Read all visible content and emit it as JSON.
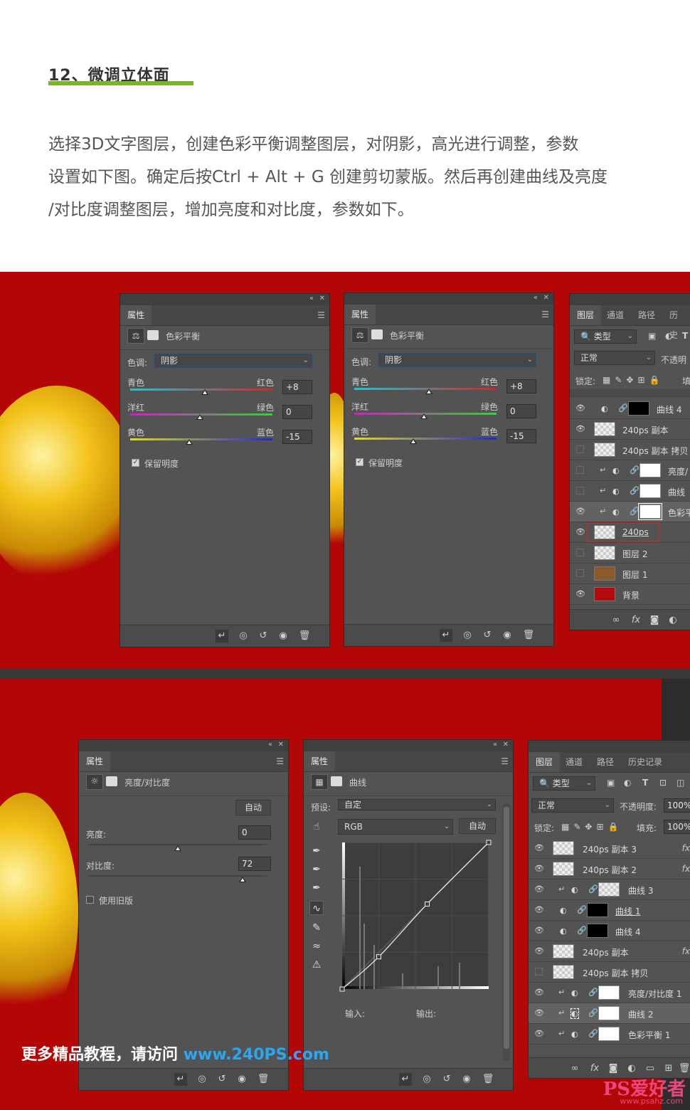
{
  "article": {
    "heading": "12、微调立体面",
    "paragraphs": [
      "选择3D文字图层，创建色彩平衡调整图层，对阴影，高光进行调整，参数",
      "设置如下图。确定后按Ctrl + Alt + G 创建剪切蒙版。然后再创建曲线及亮度",
      "/对比度调整图层，增加亮度和对比度，参数如下。"
    ]
  },
  "colors": {
    "accent_bar": "#7cb32a",
    "canvas_red": "#b30707",
    "panel_bg": "#535353",
    "promo_url": "#29a7f0"
  },
  "color_balance_1": {
    "tab": "属性",
    "title": "色彩平衡",
    "tone_label": "色调:",
    "tone_value": "阴影",
    "cyan": "青色",
    "red": "红色",
    "magenta": "洋红",
    "green": "绿色",
    "yellow": "黄色",
    "blue": "蓝色",
    "v1": "+8",
    "v2": "0",
    "v3": "-15",
    "v1_level": 0.54,
    "v2_level": 0.5,
    "v3_level": 0.43,
    "preserve": "保留明度"
  },
  "color_balance_2": {
    "tab": "属性",
    "title": "色彩平衡",
    "tone_label": "色调:",
    "tone_value": "阴影",
    "cyan": "青色",
    "red": "红色",
    "magenta": "洋红",
    "green": "绿色",
    "yellow": "黄色",
    "blue": "蓝色",
    "v1": "+8",
    "v2": "0",
    "v3": "-15",
    "preserve": "保留明度"
  },
  "layers_1": {
    "tabs": [
      "图层",
      "通道",
      "路径",
      "历史"
    ],
    "filter_label": "类型",
    "blend_mode": "正常",
    "opacity_label": "不透明",
    "lock_label": "锁定:",
    "fill_label": "填",
    "items": [
      {
        "name": "曲线 4",
        "visible": true
      },
      {
        "name": "240ps 副本",
        "visible": true
      },
      {
        "name": "240ps 副本 拷贝",
        "visible": false
      },
      {
        "name": "亮度/",
        "visible": false
      },
      {
        "name": "曲线",
        "visible": false
      },
      {
        "name": "色彩平",
        "visible": true
      },
      {
        "name": "240ps",
        "visible": true
      },
      {
        "name": "图层 2",
        "visible": false
      },
      {
        "name": "图层 1",
        "visible": false
      },
      {
        "name": "背景",
        "visible": true
      }
    ]
  },
  "brightness": {
    "tab": "属性",
    "title": "亮度/对比度",
    "auto": "自动",
    "brightness_label": "亮度:",
    "brightness_value": "0",
    "contrast_label": "对比度:",
    "contrast_value": "72",
    "legacy": "使用旧版"
  },
  "curves": {
    "tab": "属性",
    "title": "曲线",
    "preset_label": "预设:",
    "preset_value": "自定",
    "channel": "RGB",
    "auto": "自动",
    "input_label": "输入:",
    "output_label": "输出:",
    "points": [
      [
        0,
        0
      ],
      [
        25,
        22
      ],
      [
        58,
        58
      ],
      [
        100,
        100
      ]
    ]
  },
  "layers_2": {
    "tabs": [
      "图层",
      "通道",
      "路径",
      "历史记录"
    ],
    "filter_label": "类型",
    "blend_mode": "正常",
    "opacity_label": "不透明度:",
    "opacity_value": "100%",
    "lock_label": "锁定:",
    "fill_label": "填充:",
    "fill_value": "100%",
    "items": [
      {
        "name": "240ps 副本 3",
        "visible": true
      },
      {
        "name": "240ps 副本 2",
        "visible": true
      },
      {
        "name": "曲线 3",
        "visible": true
      },
      {
        "name": "曲线 1",
        "visible": true
      },
      {
        "name": "曲线 4",
        "visible": true
      },
      {
        "name": "240ps 副本",
        "visible": true
      },
      {
        "name": "240ps 副本 拷贝",
        "visible": false
      },
      {
        "name": "亮度/对比度 1",
        "visible": true
      },
      {
        "name": "曲线 2",
        "visible": true
      },
      {
        "name": "色彩平衡 1",
        "visible": true
      }
    ]
  },
  "promo": {
    "text": "更多精品教程，请访问",
    "url": "www.240PS.com"
  },
  "watermark": {
    "main": "PS爱好者",
    "sub": "www.psahz.com"
  }
}
